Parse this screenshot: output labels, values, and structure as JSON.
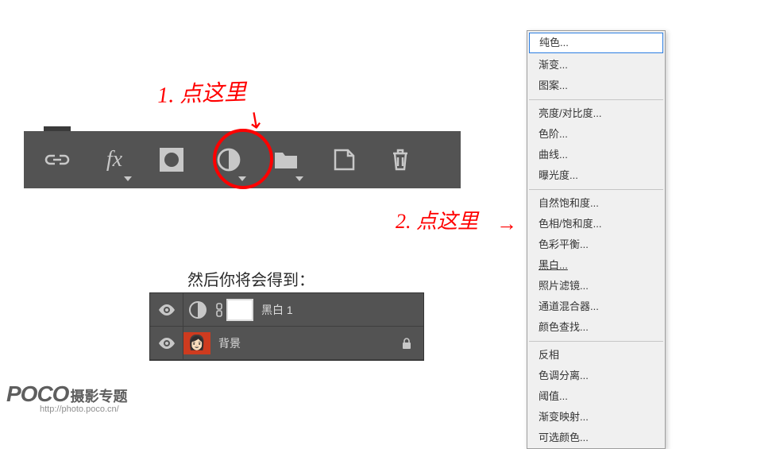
{
  "annotations": {
    "note1": "1. 点这里",
    "note2": "2. 点这里",
    "arrow1": "↘",
    "arrow2": "→"
  },
  "result_label": "然后你将会得到：",
  "toolbar": {
    "icons": [
      "link",
      "fx",
      "mask",
      "adjustment",
      "folder",
      "newlayer",
      "trash"
    ]
  },
  "layers": {
    "row1": {
      "name": "黑白 1"
    },
    "row2": {
      "name": "背景"
    }
  },
  "menu": {
    "solid": "纯色...",
    "gradient": "渐变...",
    "pattern": "图案...",
    "brightness": "亮度/对比度...",
    "levels": "色阶...",
    "curves": "曲线...",
    "exposure": "曝光度...",
    "vibrance": "自然饱和度...",
    "hue": "色相/饱和度...",
    "balance": "色彩平衡...",
    "bw": "黑白...",
    "photo_filter": "照片滤镜...",
    "mixer": "通道混合器...",
    "lookup": "颜色查找...",
    "invert": "反相",
    "posterize": "色调分离...",
    "threshold": "阈值...",
    "gradmap": "渐变映射...",
    "selective": "可选颜色..."
  },
  "logo": {
    "brand": "POCO",
    "title": "摄影专题",
    "url": "http://photo.poco.cn/"
  }
}
